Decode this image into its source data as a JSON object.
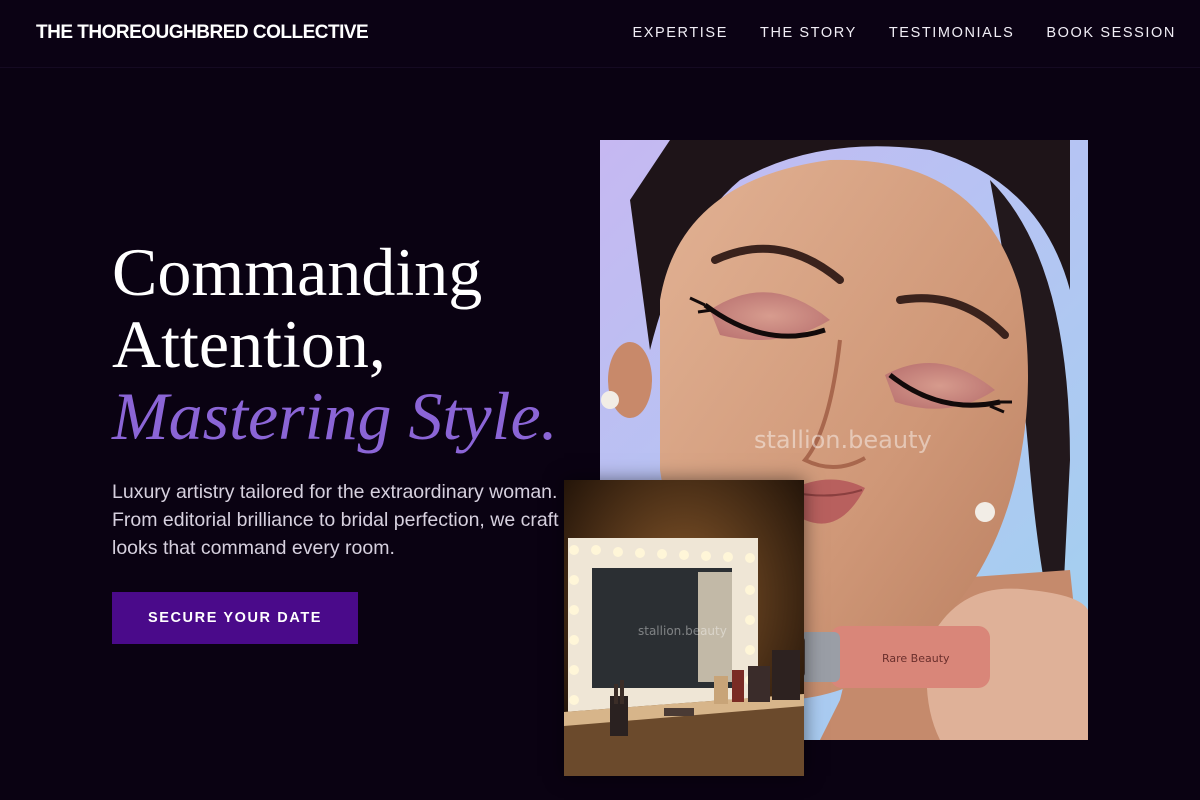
{
  "header": {
    "brand": "THE THOREOUGHBRED COLLECTIVE",
    "nav": [
      "EXPERTISE",
      "THE STORY",
      "TESTIMONIALS",
      "BOOK SESSION"
    ]
  },
  "hero": {
    "headline_line1": "Commanding",
    "headline_line2": "Attention,",
    "headline_accent": "Mastering Style.",
    "subtext": "Luxury artistry tailored for the extraordinary woman. From editorial brilliance to bridal perfection, we craft looks that command every room.",
    "cta_label": "SECURE YOUR DATE"
  },
  "images": {
    "portrait_watermark": "stallion.beauty",
    "vanity_watermark": "stallion.beauty",
    "product_label": "Rare Beauty"
  },
  "colors": {
    "background": "#0a0212",
    "accent_purple": "#8b65d6",
    "cta_background": "#4a0a8a",
    "text_light": "#d6d0de"
  }
}
